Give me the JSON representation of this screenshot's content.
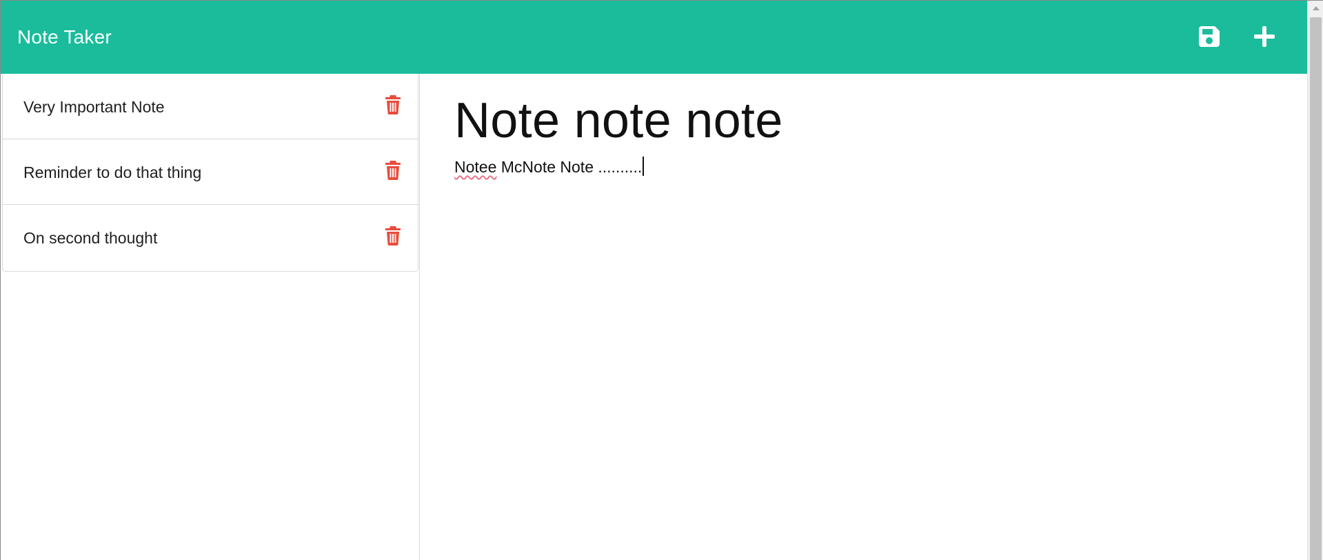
{
  "app": {
    "brand": "Note Taker",
    "accent_color": "#1abc9c",
    "delete_color": "#e74c3c"
  },
  "toolbar": {
    "save_icon": "floppy-disk-icon",
    "add_icon": "plus-icon"
  },
  "sidebar": {
    "notes": [
      {
        "title": "Very Important Note",
        "icon": "trash-icon"
      },
      {
        "title": "Reminder to do that thing",
        "icon": "trash-icon"
      },
      {
        "title": "On second thought",
        "icon": "trash-icon"
      }
    ]
  },
  "editor": {
    "title": "Note note note",
    "body_first_word": "Notee",
    "body_rest": " McNote Note .........."
  }
}
